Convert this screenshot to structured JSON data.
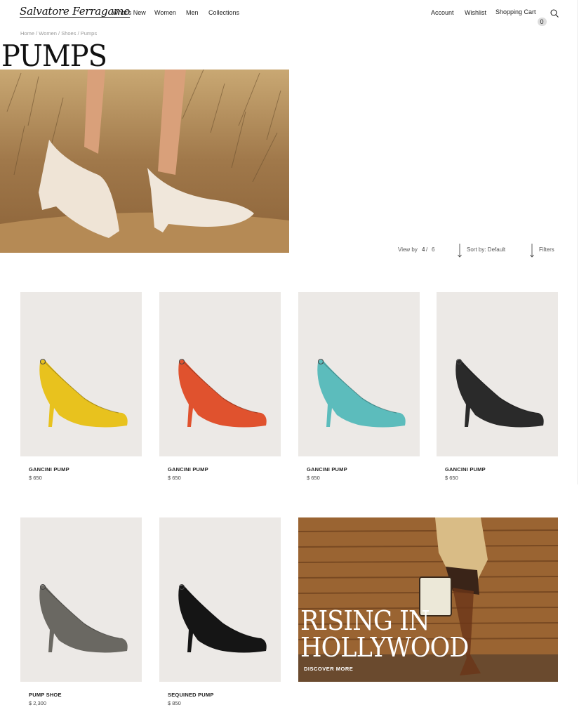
{
  "header": {
    "logo": "Salvatore Ferragamo",
    "nav": [
      "What's New",
      "Women",
      "Men",
      "Collections"
    ],
    "account": "Account",
    "wishlist": "Wishlist",
    "cart_label": "Shopping Cart",
    "cart_count": "0"
  },
  "breadcrumb": "Home / Women / Shoes / Pumps",
  "page_title": "PUMPS",
  "toolbar": {
    "view_by": "View by",
    "view_a": "4",
    "view_sep": "/",
    "view_b": "6",
    "sort": "Sort by: Default",
    "filters": "Filters"
  },
  "products": [
    {
      "name": "GANCINI PUMP",
      "price": "$ 650",
      "color": "#e8c21e"
    },
    {
      "name": "GANCINI PUMP",
      "price": "$ 650",
      "color": "#e0522e"
    },
    {
      "name": "GANCINI PUMP",
      "price": "$ 650",
      "color": "#5cbcbc"
    },
    {
      "name": "GANCINI PUMP",
      "price": "$ 650",
      "color": "#2a2a2a"
    },
    {
      "name": "PUMP SHOE",
      "price": "$ 2,300",
      "color": "#6a6862"
    },
    {
      "name": "SEQUINED PUMP",
      "price": "$ 850",
      "color": "#151515"
    }
  ],
  "promo": {
    "title_line1": "RISING IN",
    "title_line2": "HOLLYWOOD",
    "link": "DISCOVER MORE"
  }
}
